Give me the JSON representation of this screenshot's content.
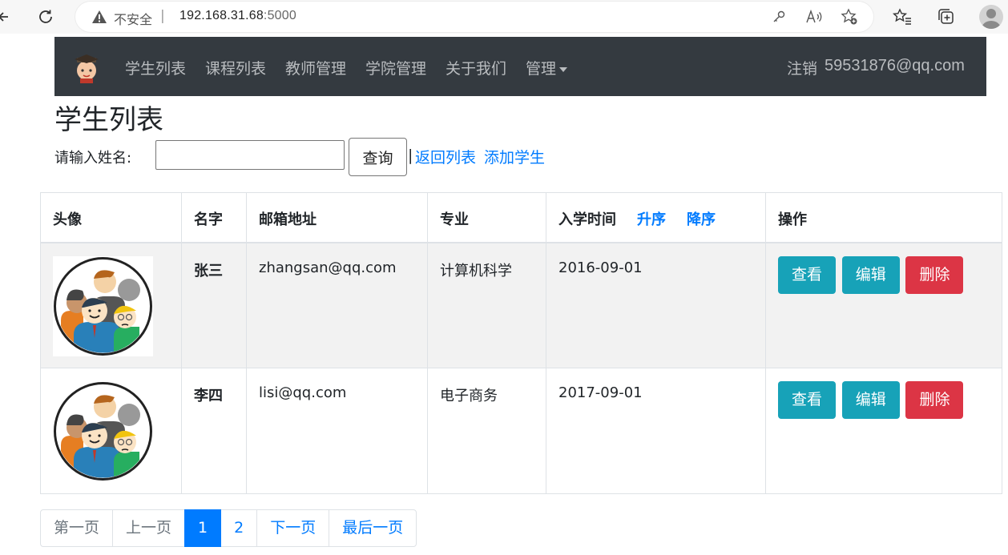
{
  "browser": {
    "security_text": "不安全",
    "separator": "|",
    "url_host": "192.168.31.68",
    "url_port": ":5000"
  },
  "navbar": {
    "items": [
      {
        "label": "学生列表"
      },
      {
        "label": "课程列表"
      },
      {
        "label": "教师管理"
      },
      {
        "label": "学院管理"
      },
      {
        "label": "关于我们"
      },
      {
        "label": "管理"
      }
    ],
    "logout_label": "注销",
    "user_email": "59531876@qq.com"
  },
  "page": {
    "title": "学生列表",
    "search_label": "请输入姓名:",
    "search_value": "",
    "query_button": "查询",
    "pipe": "|",
    "back_link": "返回列表",
    "add_link": "添加学生"
  },
  "table": {
    "headers": {
      "avatar": "头像",
      "name": "名字",
      "email": "邮箱地址",
      "major": "专业",
      "enroll": "入学时间",
      "sort_asc": "升序",
      "sort_desc": "降序",
      "actions": "操作"
    },
    "rows": [
      {
        "name": "张三",
        "email": "zhangsan@qq.com",
        "major": "计算机科学",
        "enroll": "2016-09-01"
      },
      {
        "name": "李四",
        "email": "lisi@qq.com",
        "major": "电子商务",
        "enroll": "2017-09-01"
      }
    ],
    "actions": {
      "view": "查看",
      "edit": "编辑",
      "delete": "删除"
    }
  },
  "pagination": {
    "first": "第一页",
    "prev": "上一页",
    "pages": [
      "1",
      "2"
    ],
    "current": "1",
    "next": "下一页",
    "last": "最后一页"
  },
  "colors": {
    "navbar_bg": "#343a40",
    "link": "#007bff",
    "info": "#17a2b8",
    "danger": "#dc3545"
  }
}
